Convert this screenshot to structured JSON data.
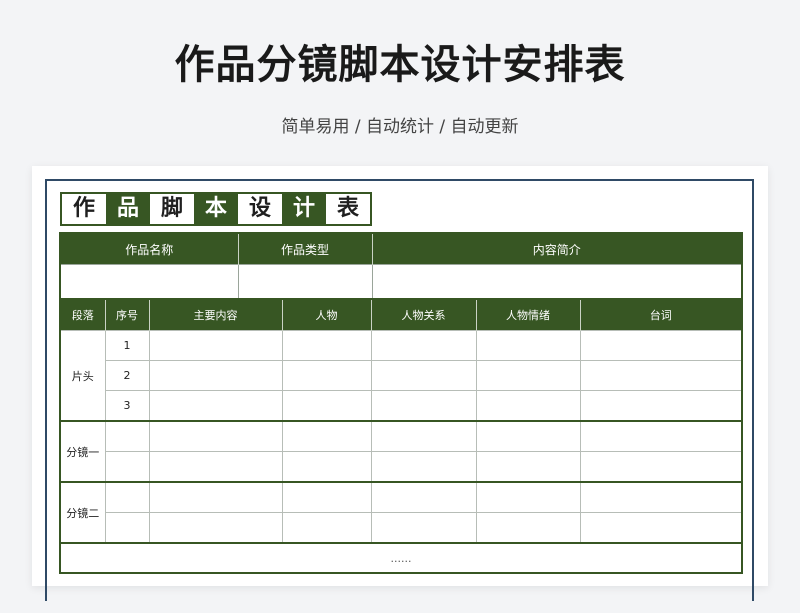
{
  "header": {
    "title": "作品分镜脚本设计安排表",
    "subtitle": "简单易用 / 自动统计 / 自动更新"
  },
  "banner": [
    "作",
    "品",
    "脚",
    "本",
    "设",
    "计",
    "表"
  ],
  "info_table": {
    "headers": [
      "作品名称",
      "作品类型",
      "内容简介"
    ]
  },
  "main_table": {
    "headers": [
      "段落",
      "序号",
      "主要内容",
      "人物",
      "人物关系",
      "人物情绪",
      "台词"
    ],
    "groups": [
      {
        "label": "片头",
        "row_numbers": [
          "1",
          "2",
          "3"
        ]
      },
      {
        "label": "分镜一",
        "row_numbers": [
          "",
          ""
        ]
      },
      {
        "label": "分镜二",
        "row_numbers": [
          "",
          ""
        ]
      }
    ],
    "ellipsis": "......"
  },
  "colors": {
    "header_green": "#375623",
    "frame_blue": "#2f4a66",
    "background": "#f3f4f6"
  }
}
